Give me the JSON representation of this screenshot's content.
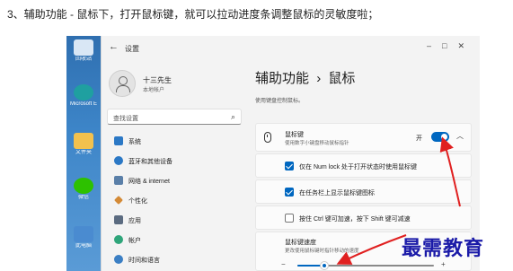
{
  "caption": "3、辅助功能 - 鼠标下，打开鼠标键，就可以拉动进度条调整鼠标的灵敏度啦；",
  "desktop": {
    "icons": [
      {
        "icon": "recycle-bin-icon",
        "label": "回收站",
        "color": "#d9e7f5"
      },
      {
        "icon": "edge-icon",
        "label": "Microsoft Edge",
        "color": "#1fa0a0"
      },
      {
        "icon": "folder-icon",
        "label": "文件夹",
        "color": "#f2c14e"
      },
      {
        "icon": "wechat-icon",
        "label": "微信",
        "color": "#2dc100"
      },
      {
        "icon": "monitor-icon",
        "label": "此电脑",
        "color": "#4a8bd0"
      }
    ]
  },
  "window": {
    "app_title": "设置",
    "back_icon": "back-arrow-icon"
  },
  "user": {
    "name": "十三先生",
    "account_type": "本地帐户"
  },
  "search": {
    "placeholder": "查找设置"
  },
  "nav": {
    "items": [
      {
        "label": "系统",
        "icon": "system-icon",
        "color": "#2b78c5"
      },
      {
        "label": "蓝牙和其他设备",
        "icon": "bluetooth-icon",
        "color": "#2b78c5"
      },
      {
        "label": "网络 & internet",
        "icon": "network-icon",
        "color": "#5a7fa8"
      },
      {
        "label": "个性化",
        "icon": "personalization-icon",
        "color": "#d48a36"
      },
      {
        "label": "应用",
        "icon": "apps-icon",
        "color": "#5b6b80"
      },
      {
        "label": "帐户",
        "icon": "accounts-icon",
        "color": "#2fa57a"
      },
      {
        "label": "时间和语言",
        "icon": "time-language-icon",
        "color": "#3b7fc4"
      }
    ]
  },
  "page": {
    "breadcrumb_parent": "辅助功能",
    "breadcrumb_separator": "›",
    "breadcrumb_current": "鼠标",
    "subtitle": "使用键盘控制鼠标。"
  },
  "mouse_keys": {
    "title": "鼠标键",
    "description": "使用数字小键盘移动鼠标指针",
    "toggle_label": "开",
    "toggle_on": true
  },
  "options": [
    {
      "label": "仅在 Num lock 处于打开状态时使用鼠标键",
      "checked": true
    },
    {
      "label": "在任务栏上显示鼠标键图标",
      "checked": true
    },
    {
      "label": "按住 Ctrl 键可加速，按下 Shift 键可减速",
      "checked": false
    }
  ],
  "speed": {
    "title": "鼠标键速度",
    "description": "更改使用鼠标键时指针移动的速度",
    "minus_label": "−",
    "plus_label": "+",
    "value_fraction": 0.2
  },
  "accent_color": "#0067c0",
  "annotation_color": "#e02020",
  "watermark": "最需教育"
}
